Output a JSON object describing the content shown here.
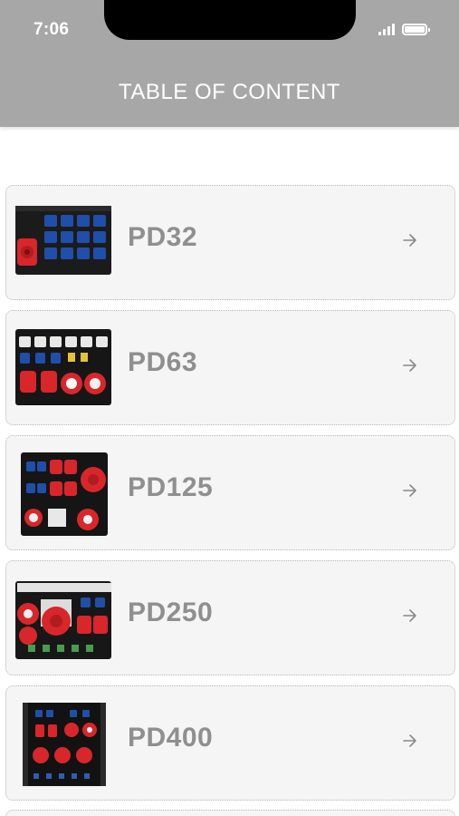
{
  "status_bar": {
    "time": "7:06"
  },
  "header": {
    "title": "TABLE OF CONTENT"
  },
  "items": [
    {
      "label": "PD32"
    },
    {
      "label": "PD63"
    },
    {
      "label": "PD125"
    },
    {
      "label": "PD250"
    },
    {
      "label": "PD400"
    }
  ],
  "colors": {
    "header_bg": "#a7a7a7",
    "card_bg": "#f5f5f5",
    "label_text": "#8f8f8f",
    "socket_blue": "#1f4fa8",
    "socket_red": "#d8262b"
  },
  "icons": {
    "arrow": "arrow-right-icon",
    "signal": "cellular-signal-icon",
    "battery": "battery-icon"
  }
}
